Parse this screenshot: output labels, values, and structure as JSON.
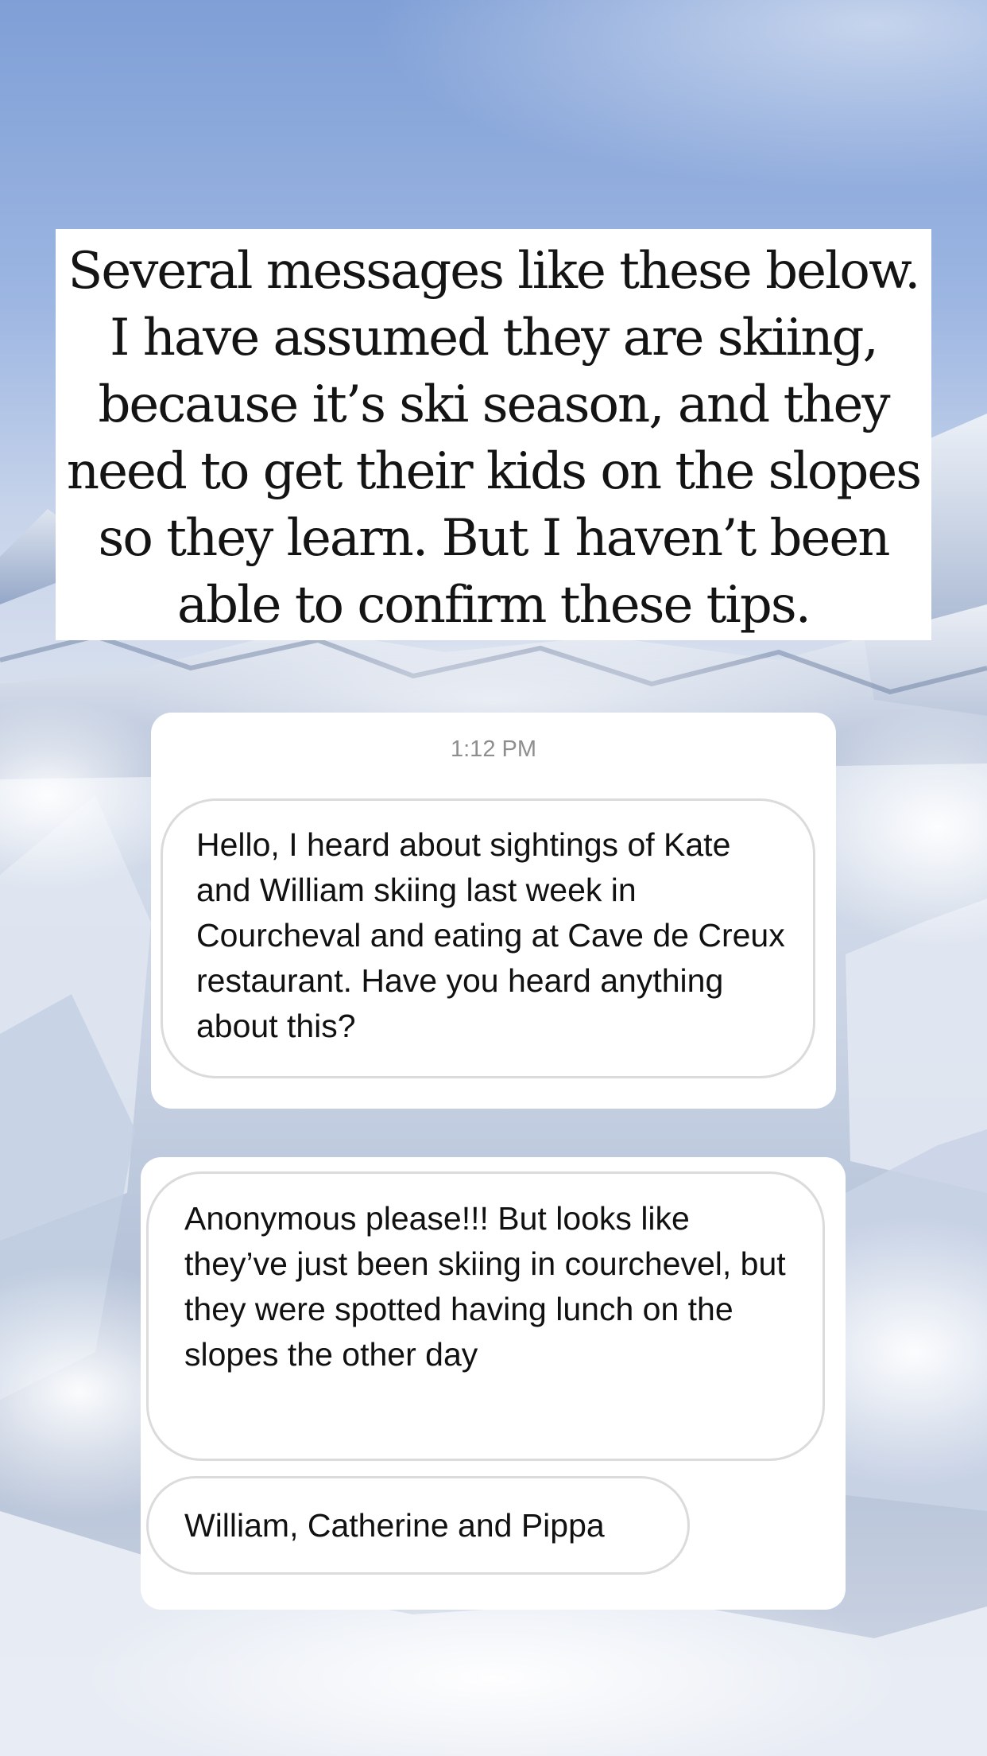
{
  "caption": {
    "text": "Several messages like these below. I have assumed they are skiing, because it’s ski season, and they need to get their kids on the slopes so they learn. But I haven’t been able to confirm these tips."
  },
  "card_1": {
    "timestamp": "1:12 PM",
    "message": "Hello, I heard about sightings of Kate and William skiing last week in Courcheval and eating at Cave de Creux restaurant. Have you heard anything about this?"
  },
  "card_2": {
    "message_1": "Anonymous please!!! But looks like they’ve just been skiing in courchevel, but they were spotted having lunch on the slopes the other day",
    "message_2": "William, Catherine and Pippa"
  },
  "colors": {
    "sky_top": "#7f9fd6",
    "snow": "#e8edf5",
    "card_bg": "#ffffff",
    "bubble_border": "#dbdbdb",
    "timestamp": "#8e8e8e"
  }
}
